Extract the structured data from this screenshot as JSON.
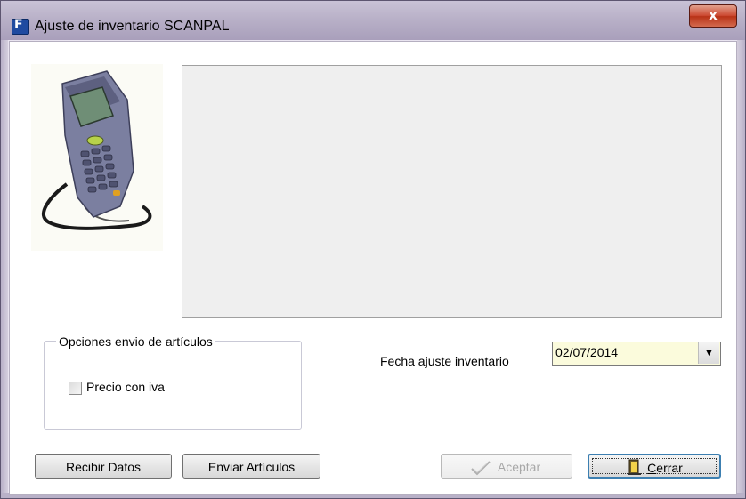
{
  "window": {
    "title": "Ajuste de inventario SCANPAL",
    "close_glyph": "x",
    "app_icon_letter": "F"
  },
  "image": {
    "name": "scanner-device-image"
  },
  "options_group": {
    "legend": "Opciones envio de artículos",
    "checkbox_label": "Precio con iva",
    "checkbox_checked": false
  },
  "date": {
    "label": "Fecha ajuste inventario",
    "value": "02/07/2014",
    "dropdown_glyph": "▼"
  },
  "buttons": {
    "recibir": "Recibir Datos",
    "enviar": "Enviar Artículos",
    "aceptar": "Aceptar",
    "cerrar_accel": "C",
    "cerrar_rest": "errar"
  },
  "icons": {
    "aceptar_icon": "check-icon",
    "cerrar_icon": "door-exit-icon"
  },
  "colors": {
    "date_field_bg": "#fbfbdc",
    "close_button": "#c8462e",
    "focus_border": "#3c7fb1"
  }
}
